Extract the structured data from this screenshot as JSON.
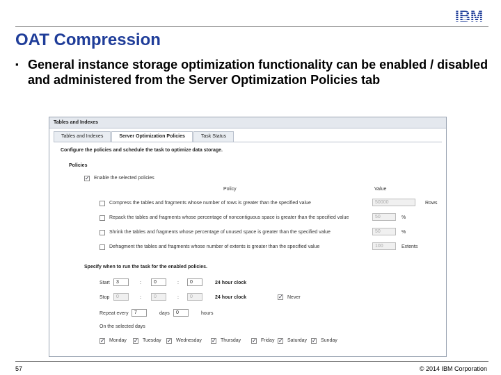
{
  "logo": {
    "text": "IBM",
    "color": "#1f3d99"
  },
  "slide": {
    "title": "OAT Compression",
    "bullet": "General instance storage optimization functionality can be enabled / disabled and administered from the Server Optimization Policies tab",
    "page_number": "57",
    "copyright": "© 2014 IBM Corporation"
  },
  "app": {
    "title": "Tables and Indexes",
    "tabs": [
      {
        "label": "Tables and Indexes",
        "active": false
      },
      {
        "label": "Server Optimization Policies",
        "active": true
      },
      {
        "label": "Task Status",
        "active": false
      }
    ],
    "intro": "Configure the policies and schedule the task to optimize data storage.",
    "policies_heading": "Policies",
    "enable_label": "Enable the selected policies",
    "enable_checked": true,
    "col_policy": "Policy",
    "col_value": "Value",
    "policies": [
      {
        "label": "Compress the tables and fragments whose number of rows is greater than the specified value",
        "value": "50000",
        "unit": "Rows",
        "checked": false
      },
      {
        "label": "Repack the tables and fragments whose percentage of noncontiguous space is greater than the specified value",
        "value": "50",
        "unit": "%",
        "checked": false
      },
      {
        "label": "Shrink the tables and fragments whose percentage of unused space is greater than the specified value",
        "value": "50",
        "unit": "%",
        "checked": false
      },
      {
        "label": "Defragment the tables and fragments whose number of extents is greater than the specified value",
        "value": "100",
        "unit": "Extents",
        "checked": false
      }
    ],
    "schedule_heading": "Specify when to run the task for the enabled policies.",
    "start_label": "Start",
    "start": {
      "h": "3",
      "m": "0",
      "s": "0"
    },
    "stop_label": "Stop",
    "stop": {
      "h": "0",
      "m": "0",
      "s": "0"
    },
    "clock_label": "24 hour clock",
    "colon": ":",
    "never_label": "Never",
    "never_checked": true,
    "repeat_label": "Repeat every",
    "repeat_days": "7",
    "days_label": "days",
    "repeat_hours": "0",
    "hours_label": "hours",
    "days_heading": "On the selected days",
    "weekdays": [
      {
        "label": "Monday",
        "checked": true
      },
      {
        "label": "Tuesday",
        "checked": true
      },
      {
        "label": "Wednesday",
        "checked": true
      },
      {
        "label": "Thursday",
        "checked": true
      },
      {
        "label": "Friday",
        "checked": true
      },
      {
        "label": "Saturday",
        "checked": true
      },
      {
        "label": "Sunday",
        "checked": true
      }
    ]
  }
}
